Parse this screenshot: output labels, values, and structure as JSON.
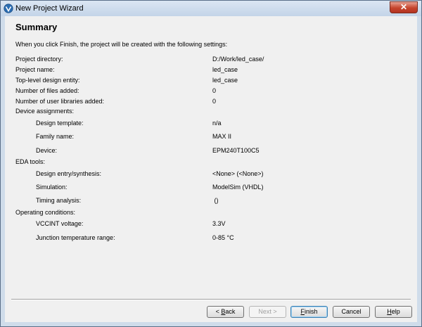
{
  "window": {
    "title": "New Project Wizard",
    "close_glyph": "✕"
  },
  "page": {
    "title": "Summary",
    "intro": "When you click Finish, the project will be created with the following settings:"
  },
  "settings": {
    "project_directory": {
      "label": "Project directory:",
      "value": "D:/Work/led_case/"
    },
    "project_name": {
      "label": "Project name:",
      "value": "led_case"
    },
    "top_level_entity": {
      "label": "Top-level design entity:",
      "value": "led_case"
    },
    "files_added": {
      "label": "Number of files added:",
      "value": "0"
    },
    "user_libraries_added": {
      "label": "Number of user libraries added:",
      "value": "0"
    },
    "device_assignments": {
      "label": "Device assignments:",
      "design_template": {
        "label": "Design template:",
        "value": "n/a"
      },
      "family_name": {
        "label": "Family name:",
        "value": "MAX II"
      },
      "device": {
        "label": "Device:",
        "value": "EPM240T100C5"
      }
    },
    "eda_tools": {
      "label": "EDA tools:",
      "design_entry": {
        "label": "Design entry/synthesis:",
        "value": "<None> (<None>)"
      },
      "simulation": {
        "label": "Simulation:",
        "value": "ModelSim (VHDL)"
      },
      "timing_analysis": {
        "label": "Timing analysis:",
        "value": " ()"
      }
    },
    "operating_conditions": {
      "label": "Operating conditions:",
      "vccint_voltage": {
        "label": "VCCINT voltage:",
        "value": "3.3V"
      },
      "junction_temp": {
        "label": "Junction temperature range:",
        "value": "0-85 °C"
      }
    }
  },
  "buttons": {
    "back": {
      "prefix": "< ",
      "mnemonic": "B",
      "rest": "ack"
    },
    "next": {
      "label": "Next >"
    },
    "finish": {
      "mnemonic": "F",
      "rest": "inish"
    },
    "cancel": {
      "label": "Cancel"
    },
    "help": {
      "mnemonic": "H",
      "rest": "elp"
    }
  },
  "colors": {
    "accent": "#3c7fb1",
    "window_frame": "#cfdcea",
    "close_red": "#c6452d"
  }
}
